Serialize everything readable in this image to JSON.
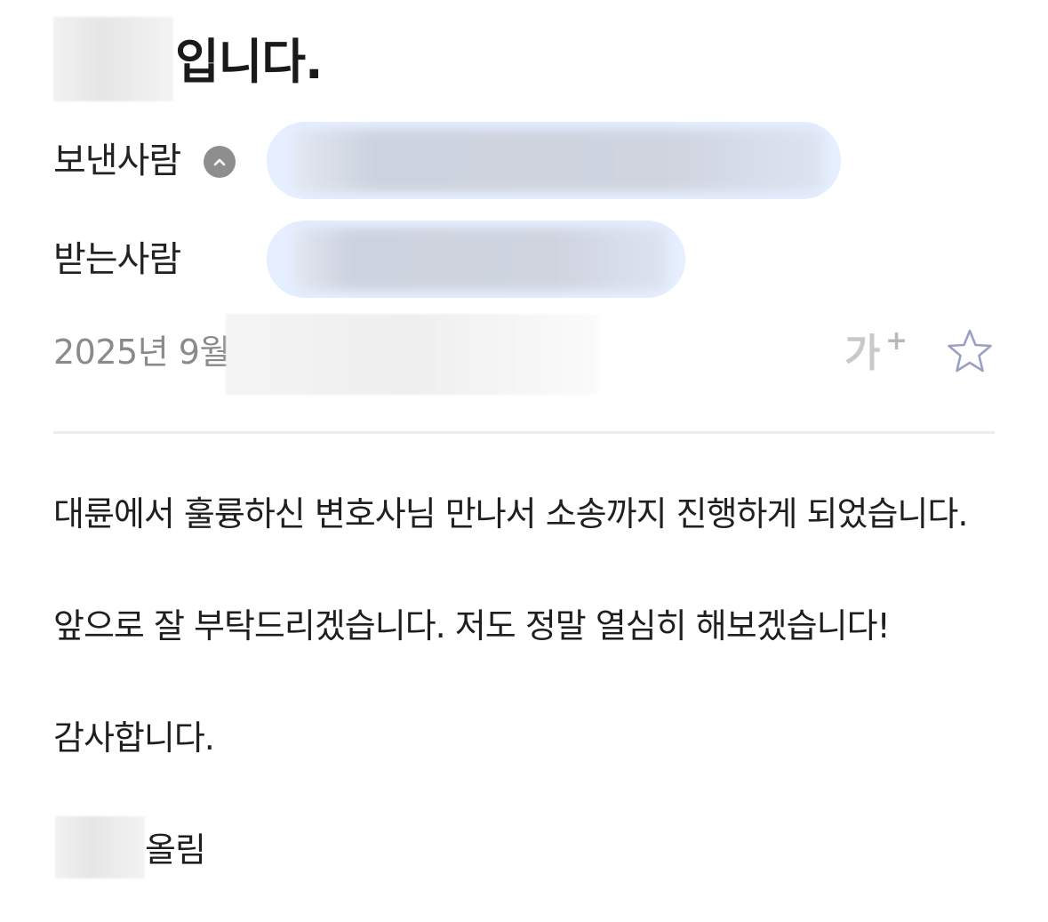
{
  "subject": {
    "suffix": "입니다."
  },
  "header": {
    "sender_label": "보낸사람",
    "recipient_label": "받는사람",
    "date_visible": "2025년 9월",
    "font_size_button": "가",
    "font_size_plus": "+"
  },
  "body": {
    "line1": "대륜에서 훌륭하신 변호사님 만나서 소송까지 진행하게 되었습니다.",
    "line2": "앞으로 잘 부탁드리겠습니다. 저도 정말 열심히 해보겠습니다!",
    "line3": "감사합니다."
  },
  "signature": {
    "suffix": "올림"
  },
  "colors": {
    "chip_background": "#e6efff",
    "muted_text": "#8a8a8a",
    "star_outline": "#9aa0c4"
  },
  "icons": {
    "collapse": "chevron-up-icon",
    "favorite": "star-outline-icon"
  }
}
